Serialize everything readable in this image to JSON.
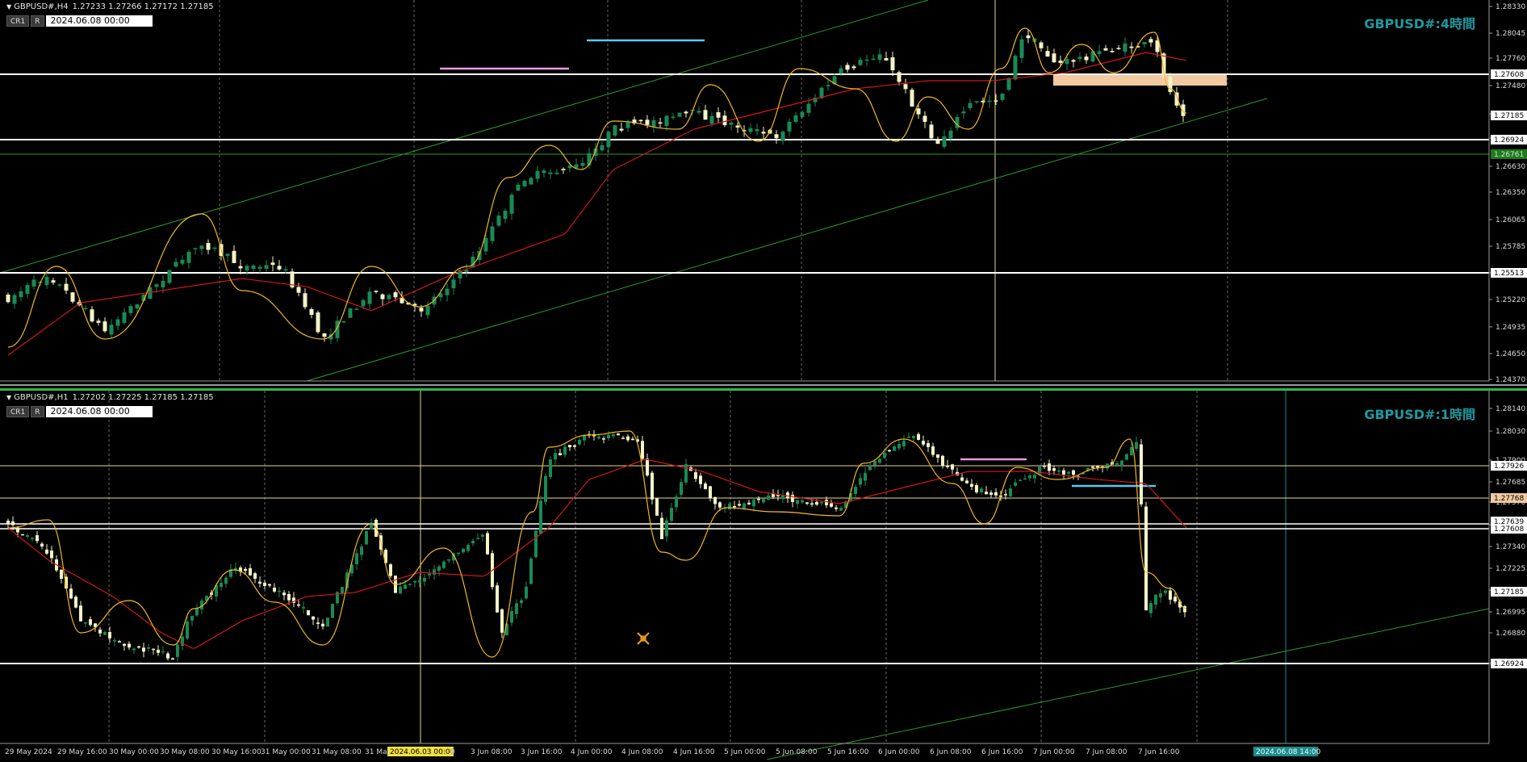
{
  "top": {
    "tri": "▼",
    "symbol": "GBPUSD#,H4",
    "ohlc": "1.27233 1.27266 1.27172 1.27185",
    "btn1": "CR1",
    "btn2": "R",
    "datetime": "2024.06.08 00:00",
    "tf_label": "GBPUSD#:4時間",
    "price_ticks": [
      "1.28330",
      "1.28045",
      "1.27760",
      "1.27480",
      "1.27185",
      "1.26924",
      "1.26630",
      "1.26350",
      "1.26065",
      "1.25785",
      "1.25513",
      "1.25220",
      "1.24935",
      "1.24650",
      "1.24370"
    ],
    "price_tags": [
      {
        "text": "1.27608",
        "bg": "#ffffff",
        "fg": "#000000"
      },
      {
        "text": "1.27185",
        "bg": "#ffffff",
        "fg": "#000000"
      },
      {
        "text": "1.26924",
        "bg": "#ffffff",
        "fg": "#000000"
      },
      {
        "text": "1.26761",
        "bg": "#1e7a1e",
        "fg": "#cfe8cf"
      },
      {
        "text": "1.25513",
        "bg": "#ffffff",
        "fg": "#000000"
      }
    ]
  },
  "bottom": {
    "tri": "▼",
    "symbol": "GBPUSD#,H1",
    "ohlc": "1.27202 1.27225 1.27185 1.27185",
    "btn1": "CR1",
    "btn2": "R",
    "datetime": "2024.06.08 00:00",
    "tf_label": "GBPUSD#:1時間",
    "price_ticks": [
      "1.28140",
      "1.28030",
      "1.27900",
      "1.27685",
      "1.27570",
      "1.27455",
      "1.27340",
      "1.27225",
      "1.27110",
      "1.26995",
      "1.26880",
      "1.26770"
    ],
    "price_tags": [
      {
        "text": "1.27926",
        "bg": "#ffffff",
        "fg": "#000000"
      },
      {
        "text": "1.27768",
        "bg": "#f2c9a0",
        "fg": "#000000"
      },
      {
        "text": "1.27639",
        "bg": "#ffffff",
        "fg": "#000000"
      },
      {
        "text": "1.27608",
        "bg": "#ffffff",
        "fg": "#000000"
      },
      {
        "text": "1.27185",
        "bg": "#ffffff",
        "fg": "#000000"
      },
      {
        "text": "1.26924",
        "bg": "#ffffff",
        "fg": "#000000"
      }
    ],
    "time_labels": [
      "29 May 2024",
      "29 May 16:00",
      "30 May 00:00",
      "30 May 08:00",
      "30 May 16:00",
      "31 May 00:00",
      "31 May 08:00",
      "31 May",
      "2024.06.03 00:00",
      "0",
      "3 Jun 08:00",
      "3 Jun 16:00",
      "4 Jun 00:00",
      "4 Jun 08:00",
      "4 Jun 16:00",
      "5 Jun 00:00",
      "5 Jun 08:00",
      "5 Jun 16:00",
      "6 Jun 00:00",
      "6 Jun 08:00",
      "6 Jun 16:00",
      "7 Jun 00:00",
      "7 Jun 08:00",
      "7 Jun 16:00"
    ],
    "crosshair_time": "2024.06.08 14:00"
  },
  "colors": {
    "bull": "#1a8a55",
    "bear": "#f4f4c8",
    "ma_red": "#d01818",
    "zigzag": "#f0b820",
    "channel": "#2c9a2c",
    "zone": "#f2c9a0",
    "pink": "#e89ae0",
    "cyan": "#5cc8f0",
    "accent": "#1e9aa0"
  }
}
